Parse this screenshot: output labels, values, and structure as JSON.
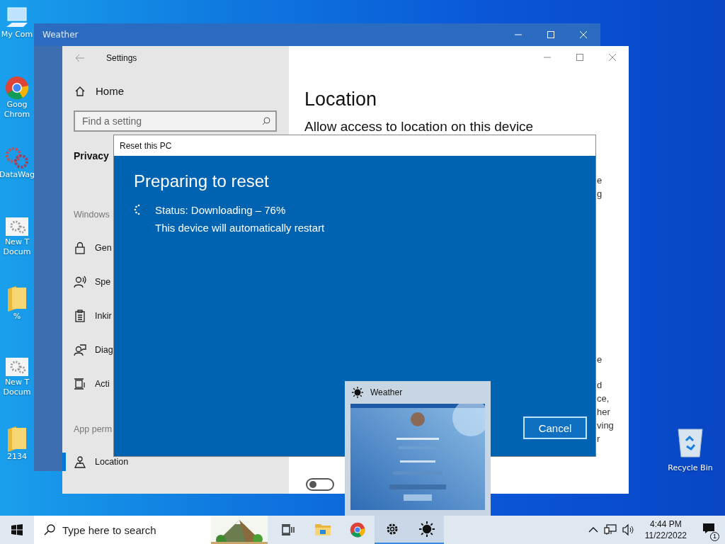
{
  "desktop_icons": [
    {
      "lines": [
        "My Com"
      ]
    },
    {
      "lines": [
        "Goog",
        "Chrom"
      ]
    },
    {
      "lines": [
        "DataWag"
      ]
    },
    {
      "lines": [
        "New T",
        "Docum"
      ]
    },
    {
      "lines": [
        "%"
      ]
    },
    {
      "lines": [
        "New T",
        "Docum"
      ]
    },
    {
      "lines": [
        "2134"
      ]
    }
  ],
  "recycle_bin": {
    "label": "Recycle Bin"
  },
  "weather_window": {
    "title": "Weather"
  },
  "settings": {
    "title": "Settings",
    "home": "Home",
    "search": {
      "placeholder": "Find a setting"
    },
    "section": "Privacy",
    "nav_groups": [
      {
        "label": "Windows",
        "items": [
          {
            "label": "Gen",
            "selected": false
          },
          {
            "label": "Spe",
            "selected": false
          },
          {
            "label": "Inkir",
            "selected": false
          },
          {
            "label": "Diag",
            "selected": false
          },
          {
            "label": "Acti",
            "selected": false
          }
        ]
      },
      {
        "label": "App perm",
        "items": [
          {
            "label": "Location",
            "selected": true
          }
        ]
      }
    ],
    "heading": "Location",
    "subheading": "Allow access to location on this device",
    "fragments": [
      [
        "e",
        "g"
      ],
      [
        "e"
      ],
      [
        "d",
        "ce,",
        "her",
        "ving",
        "r"
      ]
    ],
    "toggle": {
      "on": false
    }
  },
  "dialog": {
    "title": "Reset this PC",
    "heading": "Preparing to reset",
    "status": "Status: Downloading – 76%",
    "note": "This device will automatically restart",
    "button": "Cancel"
  },
  "thumbnail": {
    "title": "Weather"
  },
  "taskbar": {
    "search": {
      "placeholder": "Type here to search"
    },
    "apps": [
      {
        "selected": false
      },
      {
        "selected": false
      },
      {
        "selected": false
      },
      {
        "selected": true
      },
      {
        "selected": true
      }
    ],
    "time": "4:44 PM",
    "date": "11/22/2022",
    "notifications": "1"
  }
}
